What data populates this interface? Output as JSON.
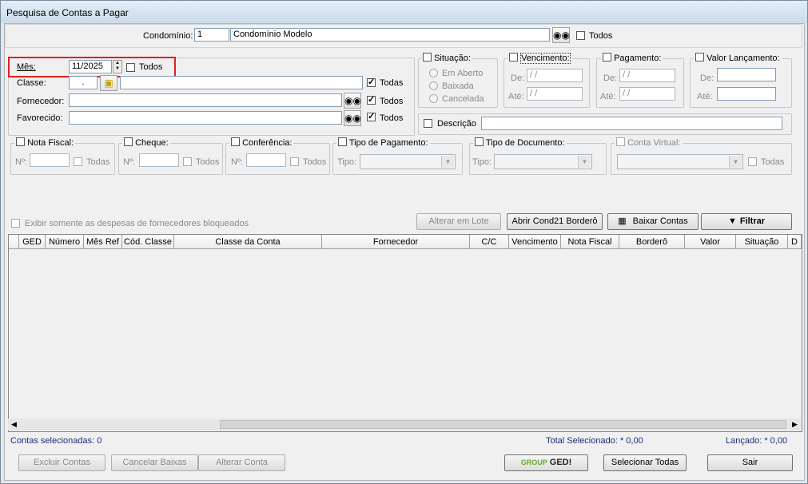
{
  "window": {
    "title": "Pesquisa de Contas a Pagar"
  },
  "condominio": {
    "label": "Condomínio:",
    "code": "1",
    "name": "Condomínio Modelo",
    "todos_label": "Todos"
  },
  "mes": {
    "label": "Mês:",
    "value": "11/2025",
    "todos_label": "Todos"
  },
  "classe": {
    "label": "Classe:",
    "code": ".",
    "value": "",
    "todas_label": "Todas"
  },
  "fornecedor": {
    "label": "Fornecedor:",
    "value": "",
    "todos_label": "Todos"
  },
  "favorecido": {
    "label": "Favorecido:",
    "value": "",
    "todos_label": "Todos"
  },
  "situacao": {
    "label": "Situação:",
    "options": [
      "Em Aberto",
      "Baixada",
      "Cancelada"
    ]
  },
  "vencimento": {
    "label": "Vencimento:",
    "de_label": "De:",
    "ate_label": "Até:",
    "de_value": " / /",
    "ate_value": " / /"
  },
  "pagamento": {
    "label": "Pagamento:",
    "de_label": "De:",
    "ate_label": "Até:",
    "de_value": " / /",
    "ate_value": " / /"
  },
  "valor_lancamento": {
    "label": "Valor Lançamento:",
    "de_label": "De:",
    "ate_label": "Até:",
    "de_value": "",
    "ate_value": ""
  },
  "descricao": {
    "label": "Descrição",
    "value": ""
  },
  "nota_fiscal": {
    "label": "Nota Fiscal:",
    "num_label": "Nº:",
    "todas_label": "Todas"
  },
  "cheque": {
    "label": "Cheque:",
    "num_label": "Nº:",
    "todos_label": "Todos"
  },
  "conferencia": {
    "label": "Conferência:",
    "num_label": "Nº:",
    "todos_label": "Todos"
  },
  "tipo_pagamento": {
    "label": "Tipo de Pagamento:",
    "tipo_label": "Tipo:"
  },
  "tipo_documento": {
    "label": "Tipo de Documento:",
    "tipo_label": "Tipo:"
  },
  "conta_virtual": {
    "label": "Conta Virtual:",
    "todas_label": "Todas"
  },
  "fornecedores_bloqueados": {
    "label": "Exibir somente as despesas de fornecedores bloqueados"
  },
  "actions": {
    "alterar_lote": "Alterar em Lote",
    "abrir_bordero": "Abrir Cond21 Borderô",
    "baixar_contas": "Baixar Contas",
    "filtrar": "Filtrar"
  },
  "table": {
    "columns": [
      "GED",
      "Número",
      "Mês Ref",
      "Cód. Classe",
      "Classe da Conta",
      "Fornecedor",
      "C/C",
      "Vencimento",
      "Nota Fiscal",
      "Borderô",
      "Valor",
      "Situação",
      "D"
    ],
    "rows": []
  },
  "status": {
    "contas_selecionadas": "Contas selecionadas: 0",
    "total_selecionado": "Total Selecionado: * 0,00",
    "lancado": "Lançado: * 0,00"
  },
  "footer": {
    "excluir": "Excluir Contas",
    "cancelar_baixas": "Cancelar Baixas",
    "alterar_conta": "Alterar Conta",
    "ged_group": "GROUP",
    "ged_name": "GED!",
    "selecionar_todas": "Selecionar Todas",
    "sair": "Sair"
  },
  "colors": {
    "highlight": "#e02020",
    "status_text": "#1a2e7a",
    "ged_green": "#6aa82a"
  }
}
